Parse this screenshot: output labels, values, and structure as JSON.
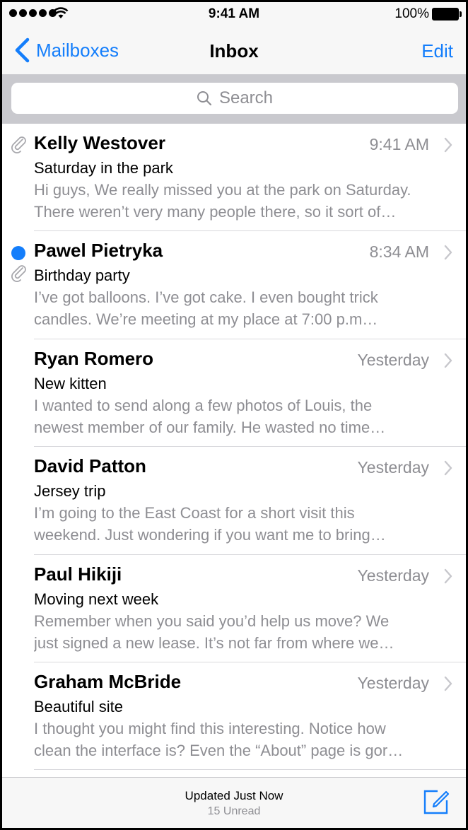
{
  "status": {
    "time": "9:41 AM",
    "battery": "100%"
  },
  "nav": {
    "back_label": "Mailboxes",
    "title": "Inbox",
    "edit_label": "Edit"
  },
  "search": {
    "placeholder": "Search"
  },
  "messages": [
    {
      "sender": "Kelly Westover",
      "time": "9:41 AM",
      "subject": "Saturday in the park",
      "preview1": "Hi guys, We really missed you at the park on Saturday.",
      "preview2": "There weren’t very many people there, so it sort of…",
      "unread": false,
      "attachment": true
    },
    {
      "sender": "Pawel Pietryka",
      "time": "8:34 AM",
      "subject": "Birthday party",
      "preview1": "I’ve got balloons. I’ve got cake. I even bought trick",
      "preview2": "candles. We’re meeting at my place at 7:00 p.m…",
      "unread": true,
      "attachment": true
    },
    {
      "sender": "Ryan Romero",
      "time": "Yesterday",
      "subject": "New kitten",
      "preview1": "I wanted to send along a few photos of Louis, the",
      "preview2": "newest member of our family. He wasted no time…",
      "unread": false,
      "attachment": false
    },
    {
      "sender": "David Patton",
      "time": "Yesterday",
      "subject": "Jersey trip",
      "preview1": "I’m going to the East Coast for a short visit this",
      "preview2": "weekend. Just wondering if you want me to bring…",
      "unread": false,
      "attachment": false
    },
    {
      "sender": "Paul Hikiji",
      "time": "Yesterday",
      "subject": "Moving next week",
      "preview1": "Remember when you said you’d help us move? We",
      "preview2": "just signed a new lease. It’s not far from where we…",
      "unread": false,
      "attachment": false
    },
    {
      "sender": "Graham McBride",
      "time": "Yesterday",
      "subject": "Beautiful site",
      "preview1": "I thought you might find this interesting. Notice how",
      "preview2": "clean the interface is? Even the “About” page is gor…",
      "unread": false,
      "attachment": false
    }
  ],
  "toolbar": {
    "updated": "Updated Just Now",
    "unread_count": "15 Unread"
  },
  "colors": {
    "accent": "#147efb",
    "secondary_text": "#8e8e93",
    "search_bg": "#c9c9ce"
  },
  "icons": [
    "signal-dots-icon",
    "wifi-icon",
    "battery-icon",
    "chevron-left-icon",
    "search-icon",
    "attachment-icon",
    "chevron-right-icon",
    "compose-icon"
  ]
}
